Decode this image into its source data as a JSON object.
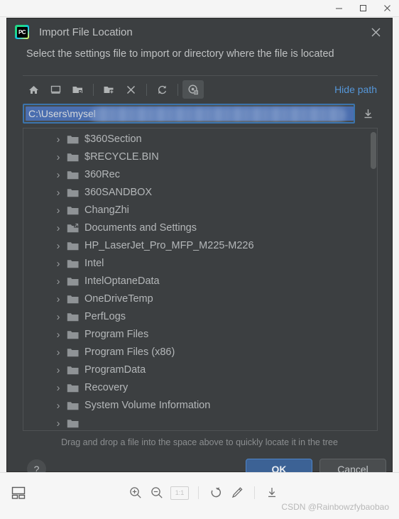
{
  "os_window": {
    "controls": [
      {
        "name": "minimize",
        "icon": "minimize-icon"
      },
      {
        "name": "maximize",
        "icon": "maximize-icon"
      },
      {
        "name": "close",
        "icon": "close-icon"
      }
    ]
  },
  "dialog": {
    "app_icon_label": "PC",
    "title": "Import File Location",
    "close_label": "✕",
    "subtitle": "Select the settings file to import or directory where the file is located",
    "toolbar": {
      "buttons": [
        {
          "name": "home-icon",
          "title": "Home"
        },
        {
          "name": "desktop-icon",
          "title": "Desktop"
        },
        {
          "name": "project-folder-icon",
          "title": "Project Directory"
        },
        {
          "name": "new-folder-icon",
          "title": "New Folder"
        },
        {
          "name": "delete-icon",
          "title": "Delete"
        },
        {
          "name": "refresh-icon",
          "title": "Refresh"
        },
        {
          "name": "toggle-hidden-icon",
          "title": "Show Hidden Files",
          "active": true
        }
      ],
      "hide_path_label": "Hide path"
    },
    "path_field": {
      "value": "C:\\Users\\mysel",
      "redacted": true,
      "selected": true,
      "download_icon": "download-icon"
    },
    "tree": {
      "items": [
        {
          "label": "$360Section",
          "icon": "folder-icon",
          "shortcut": false
        },
        {
          "label": "$RECYCLE.BIN",
          "icon": "folder-icon",
          "shortcut": false
        },
        {
          "label": "360Rec",
          "icon": "folder-icon",
          "shortcut": false
        },
        {
          "label": "360SANDBOX",
          "icon": "folder-icon",
          "shortcut": false
        },
        {
          "label": "ChangZhi",
          "icon": "folder-icon",
          "shortcut": false
        },
        {
          "label": "Documents and Settings",
          "icon": "folder-shortcut-icon",
          "shortcut": true
        },
        {
          "label": "HP_LaserJet_Pro_MFP_M225-M226",
          "icon": "folder-icon",
          "shortcut": false
        },
        {
          "label": "Intel",
          "icon": "folder-icon",
          "shortcut": false
        },
        {
          "label": "IntelOptaneData",
          "icon": "folder-icon",
          "shortcut": false
        },
        {
          "label": "OneDriveTemp",
          "icon": "folder-icon",
          "shortcut": false
        },
        {
          "label": "PerfLogs",
          "icon": "folder-icon",
          "shortcut": false
        },
        {
          "label": "Program Files",
          "icon": "folder-icon",
          "shortcut": false
        },
        {
          "label": "Program Files (x86)",
          "icon": "folder-icon",
          "shortcut": false
        },
        {
          "label": "ProgramData",
          "icon": "folder-icon",
          "shortcut": false
        },
        {
          "label": "Recovery",
          "icon": "folder-icon",
          "shortcut": false
        },
        {
          "label": "System Volume Information",
          "icon": "folder-icon",
          "shortcut": false
        },
        {
          "label": "",
          "icon": "folder-icon",
          "shortcut": false
        }
      ],
      "expander_glyph": "›"
    },
    "hint": "Drag and drop a file into the space above to quickly locate it in the tree",
    "footer": {
      "help_label": "?",
      "ok_label": "OK",
      "cancel_label": "Cancel"
    }
  },
  "viewer_bar": {
    "layout_icon": "gallery-layout-icon",
    "buttons": [
      {
        "name": "zoom-in-icon",
        "label": ""
      },
      {
        "name": "zoom-out-icon",
        "label": ""
      },
      {
        "name": "actual-size-button",
        "label": "1:1"
      },
      {
        "name": "rotate-icon",
        "label": ""
      },
      {
        "name": "edit-icon",
        "label": ""
      },
      {
        "name": "download-icon",
        "label": ""
      }
    ],
    "watermark": "CSDN @Rainbowzfybaobao"
  },
  "colors": {
    "dialog_bg": "#3c3f41",
    "accent_blue": "#4b6eaf",
    "link_blue": "#5596d8",
    "ok_button": "#3c6295",
    "text": "#b4b7b9"
  }
}
